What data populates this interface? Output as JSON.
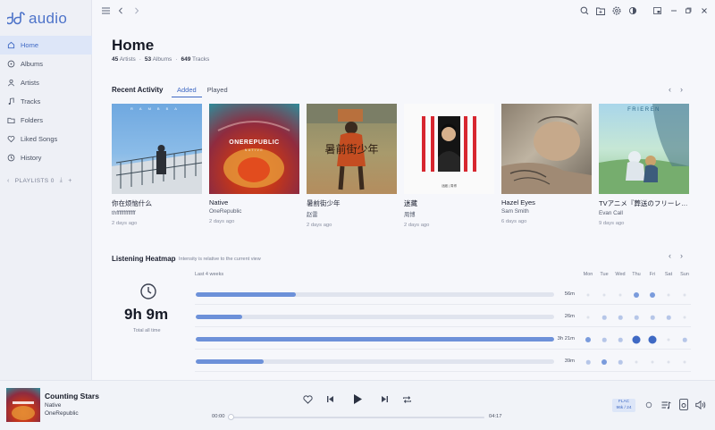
{
  "app": {
    "logo_text": "audio",
    "accent": "#3f69c4"
  },
  "sidebar": {
    "items": [
      {
        "label": "Home",
        "icon": "home-icon",
        "active": true
      },
      {
        "label": "Albums",
        "icon": "disc-icon"
      },
      {
        "label": "Artists",
        "icon": "artists-icon"
      },
      {
        "label": "Tracks",
        "icon": "music-note-icon"
      },
      {
        "label": "Folders",
        "icon": "folder-icon"
      },
      {
        "label": "Liked Songs",
        "icon": "heart-icon"
      },
      {
        "label": "History",
        "icon": "history-icon"
      }
    ],
    "playlists_label": "PLAYLISTS",
    "playlists_count": "0"
  },
  "topbar": {
    "icons": [
      "menu-icon",
      "back-icon",
      "forward-icon",
      "search-icon",
      "folder-add-icon",
      "settings-icon",
      "theme-icon",
      "mini-player-icon",
      "minimize-icon",
      "maximize-icon",
      "close-icon"
    ]
  },
  "home": {
    "title": "Home",
    "artists_count": "45",
    "artists_label": "Artists",
    "albums_count": "53",
    "albums_label": "Albums",
    "tracks_count": "649",
    "tracks_label": "Tracks",
    "separator": "·"
  },
  "recent": {
    "title": "Recent Activity",
    "tabs": [
      {
        "label": "Added",
        "active": true
      },
      {
        "label": "Played"
      }
    ],
    "albums": [
      {
        "title": "你在烦恼什么",
        "artist": "thfffffffffffff",
        "date": "2 days ago"
      },
      {
        "title": "Native",
        "artist": "OneRepublic",
        "date": "2 days ago"
      },
      {
        "title": "暑前街少年",
        "artist": "赵雷",
        "date": "2 days ago"
      },
      {
        "title": "迷藏",
        "artist": "周博",
        "date": "2 days ago"
      },
      {
        "title": "Hazel Eyes",
        "artist": "Sam Smith",
        "date": "6 days ago"
      },
      {
        "title": "TVアニメ『葬送のフリーレン』",
        "artist": "Evan Call",
        "date": "9 days ago"
      }
    ],
    "cover_texts": {
      "c1": "RAMBBA",
      "c2_main": "ONEREPUBLIC",
      "c2_sub": "NATIVE",
      "c3": "暑前街少年",
      "c4": "迷藏 | 周博",
      "c6": "FRIEREN"
    }
  },
  "heatmap": {
    "title": "Listening Heatmap",
    "subtitle": "Intensity is relative to the current view",
    "total": "9h 9m",
    "total_caption": "Total all time",
    "weeks_caption": "Last 4 weeks",
    "days": [
      "Mon",
      "Tue",
      "Wed",
      "Thu",
      "Fri",
      "Sat",
      "Sun"
    ],
    "rows": [
      {
        "label": "56m",
        "fraction": 0.28,
        "cells": [
          0,
          0,
          0,
          0.25,
          0.35,
          0,
          0
        ]
      },
      {
        "label": "26m",
        "fraction": 0.13,
        "cells": [
          0,
          0.05,
          0.05,
          0.1,
          0.1,
          0.05,
          0
        ]
      },
      {
        "label": "3h 21m",
        "fraction": 1.0,
        "cells": [
          0.25,
          0.1,
          0.1,
          1.0,
          1.0,
          0,
          0.15
        ]
      },
      {
        "label": "39m",
        "fraction": 0.19,
        "cells": [
          0.05,
          0.3,
          0.05,
          0,
          0,
          0,
          0
        ]
      }
    ]
  },
  "player": {
    "title": "Counting Stars",
    "album": "Native",
    "artist": "OneRepublic",
    "time_current": "00:00",
    "time_total": "04:17",
    "progress": 0,
    "format": "FLAC",
    "quality": "96k / 24"
  }
}
